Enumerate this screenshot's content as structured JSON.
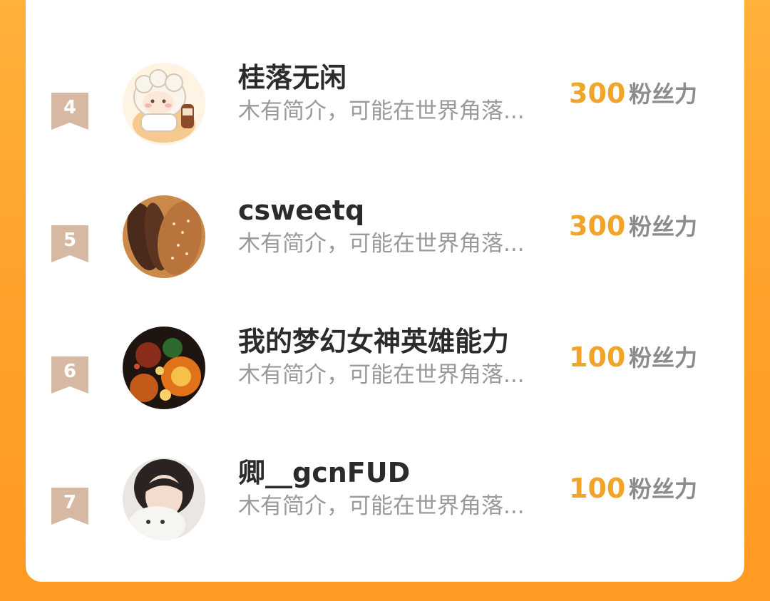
{
  "colors": {
    "background_orange": "#ffa42c",
    "panel": "#ffffff",
    "score": "#f1a42a",
    "rank_badge": "#d7b9a3",
    "name": "#2b2b2b",
    "intro": "#9a9a9a"
  },
  "rows": [
    {
      "rank": "4",
      "name": "桂落无闲",
      "intro": "木有简介，可能在世界角落...",
      "score": "300",
      "score_label": "粉丝力",
      "avatar": "sheep-cartoon-avatar"
    },
    {
      "rank": "5",
      "name": "csweetq",
      "intro": "木有简介，可能在世界角落...",
      "score": "300",
      "score_label": "粉丝力",
      "avatar": "sausage-bread-avatar"
    },
    {
      "rank": "6",
      "name": "我的梦幻女神英雄能力",
      "intro": "木有简介，可能在世界角落...",
      "score": "100",
      "score_label": "粉丝力",
      "avatar": "fireworks-avatar"
    },
    {
      "rank": "7",
      "name": "卿__gcnFUD",
      "intro": "木有简介，可能在世界角落...",
      "score": "100",
      "score_label": "粉丝力",
      "avatar": "girl-with-cat-avatar"
    }
  ]
}
